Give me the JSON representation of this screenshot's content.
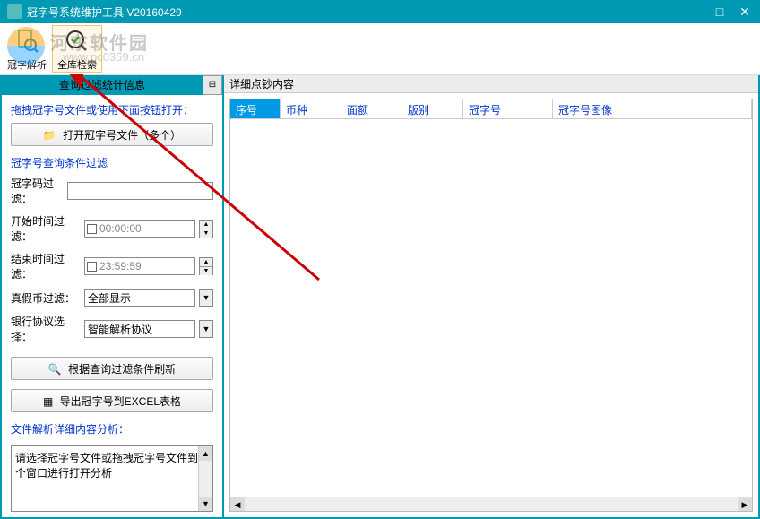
{
  "window": {
    "title": "冠字号系统维护工具 V20160429"
  },
  "watermark": {
    "text1": "河东软件园",
    "text2": "www.pc0359.cn"
  },
  "toolbar": {
    "buttons": [
      {
        "label": "冠字解析",
        "icon": "search-doc"
      },
      {
        "label": "全库检索",
        "icon": "check-circle"
      }
    ]
  },
  "leftPanel": {
    "header": "查询过滤统计信息",
    "dragHint": "拖拽冠字号文件或使用下面按钮打开：",
    "openBtn": "打开冠字号文件（多个）",
    "filterHeader": "冠字号查询条件过滤",
    "filters": {
      "codeLabel": "冠字码过滤：",
      "codeValue": "",
      "startLabel": "开始时间过滤：",
      "startValue": "00:00:00",
      "endLabel": "结束时间过滤：",
      "endValue": "23:59:59",
      "authLabel": "真假币过滤：",
      "authValue": "全部显示",
      "bankLabel": "银行协议选择：",
      "bankValue": "智能解析协议"
    },
    "refreshBtn": "根据查询过滤条件刷新",
    "exportBtn": "导出冠字号到EXCEL表格",
    "detailHeader": "文件解析详细内容分析：",
    "detailText": "请选择冠字号文件或拖拽冠字号文件到这个窗口进行打开分析"
  },
  "rightPanel": {
    "header": "详细点钞内容",
    "columns": [
      "序号",
      "币种",
      "面额",
      "版别",
      "冠字号",
      "冠字号图像"
    ]
  }
}
